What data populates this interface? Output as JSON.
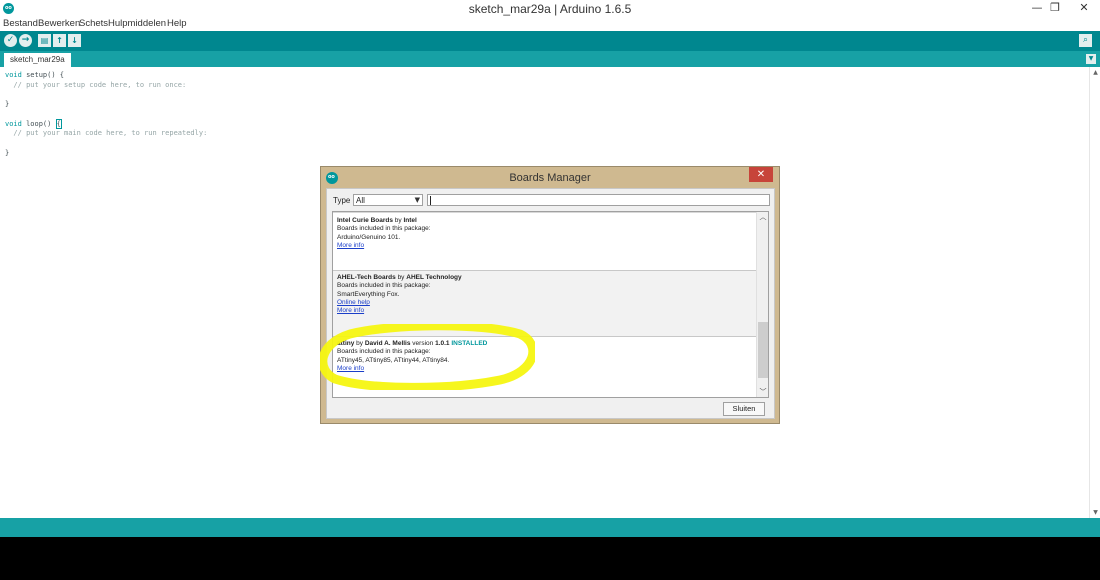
{
  "window": {
    "title": "sketch_mar29a | Arduino 1.6.5",
    "logo_text": "oo",
    "minimize": "—",
    "maximize": "❐",
    "close": "✕"
  },
  "menu": {
    "items": [
      "Bestand",
      "Bewerken",
      "Schets",
      "Hulpmiddelen",
      "Help"
    ]
  },
  "toolbar": {
    "verify": "✓",
    "upload": "→",
    "new": "▤",
    "open": "↑",
    "save": "↓",
    "serial_monitor": "⌕"
  },
  "tabs": {
    "active": "sketch_mar29a",
    "menu_icon": "▼"
  },
  "editor": {
    "line1_kw": "void",
    "line1_rest": " setup() {",
    "line2": "  // put your setup code here, to run once:",
    "line4": "}",
    "line6_kw": "void",
    "line6_rest": " loop() ",
    "line6_bracket": "{",
    "line7": "  // put your main code here, to run repeatedly:",
    "line9": "}"
  },
  "dialog": {
    "title": "Boards Manager",
    "close_icon": "✕",
    "logo_text": "oo",
    "type_label": "Type",
    "type_value": "All",
    "close_button": "Sluiten",
    "entries": [
      {
        "name": "Intel Curie Boards",
        "by": "by",
        "author": "Intel",
        "included": "Boards included in this package:",
        "boards": "Arduino/Genuino 101.",
        "link": "More info"
      },
      {
        "name": "AHEL-Tech Boards",
        "by": "by",
        "author": "AHEL Technology",
        "included": "Boards included in this package:",
        "boards": "SmartEverything Fox.",
        "link1": "Online help",
        "link2": "More info"
      },
      {
        "name": "attiny",
        "by": "by",
        "author": "David A. Mellis",
        "version_label": "version",
        "version": "1.0.1",
        "status": "INSTALLED",
        "included": "Boards included in this package:",
        "boards": "ATtiny45, ATtiny85, ATtiny44, ATtiny84.",
        "link": "More info"
      }
    ]
  },
  "colors": {
    "toolbar": "#00878f",
    "tabbar": "#17a1a5",
    "dialog_frame": "#cfb990",
    "highlight": "#f5f511",
    "installed": "#00979c"
  }
}
